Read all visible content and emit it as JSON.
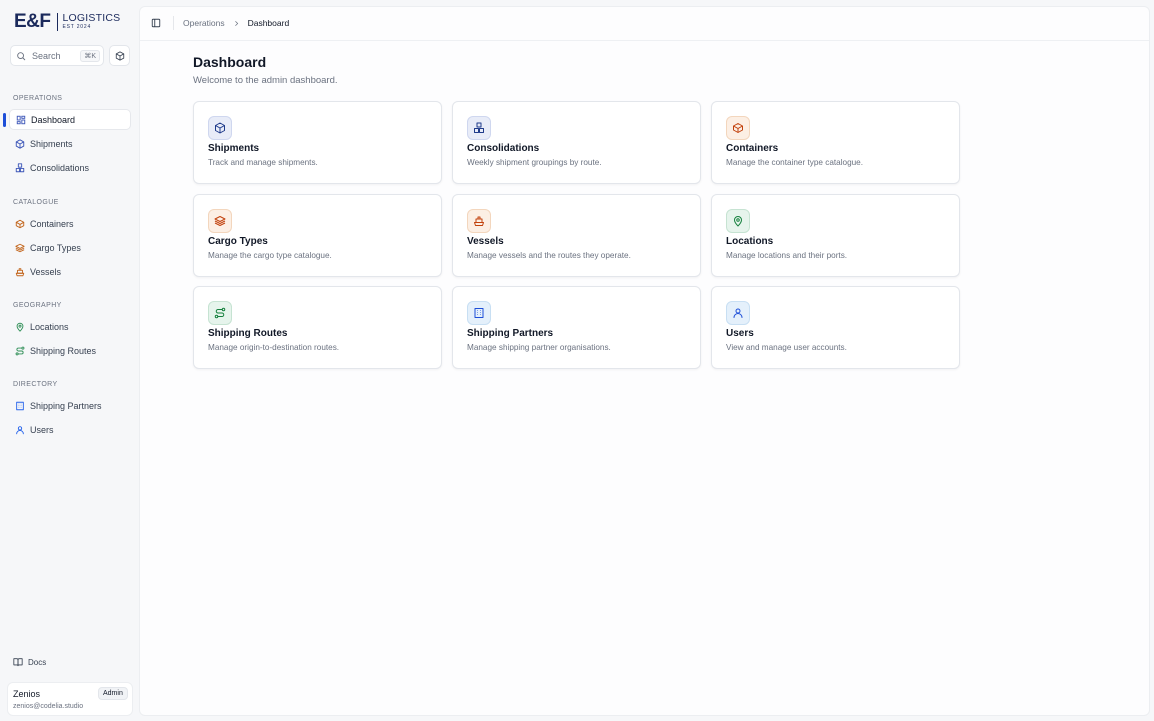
{
  "brand": {
    "mark": "E&F",
    "word": "LOGISTICS",
    "est": "EST 2024"
  },
  "search": {
    "label": "Search",
    "shortcut": "⌘K"
  },
  "sidebar": {
    "sections": [
      {
        "label": "OPERATIONS",
        "items": [
          {
            "label": "Dashboard",
            "icon": "dashboard-icon",
            "active": true
          },
          {
            "label": "Shipments",
            "icon": "box-icon"
          },
          {
            "label": "Consolidations",
            "icon": "boxes-icon"
          }
        ]
      },
      {
        "label": "CATALOGUE",
        "items": [
          {
            "label": "Containers",
            "icon": "container-icon"
          },
          {
            "label": "Cargo Types",
            "icon": "layers-icon"
          },
          {
            "label": "Vessels",
            "icon": "ship-icon"
          }
        ]
      },
      {
        "label": "GEOGRAPHY",
        "items": [
          {
            "label": "Locations",
            "icon": "map-pin-icon"
          },
          {
            "label": "Shipping Routes",
            "icon": "route-icon"
          }
        ]
      },
      {
        "label": "DIRECTORY",
        "items": [
          {
            "label": "Shipping Partners",
            "icon": "building-icon"
          },
          {
            "label": "Users",
            "icon": "user-icon"
          }
        ]
      }
    ],
    "docs": "Docs"
  },
  "user": {
    "name": "Zenios",
    "email": "zenios@codelia.studio",
    "role": "Admin"
  },
  "breadcrumb": {
    "parent": "Operations",
    "current": "Dashboard"
  },
  "page": {
    "title": "Dashboard",
    "subtitle": "Welcome to the admin dashboard."
  },
  "cards": [
    {
      "title": "Shipments",
      "desc": "Track and manage shipments.",
      "icon": "box-icon",
      "tone": "blue"
    },
    {
      "title": "Consolidations",
      "desc": "Weekly shipment groupings by route.",
      "icon": "boxes-icon",
      "tone": "blue"
    },
    {
      "title": "Containers",
      "desc": "Manage the container type catalogue.",
      "icon": "container-icon",
      "tone": "orange"
    },
    {
      "title": "Cargo Types",
      "desc": "Manage the cargo type catalogue.",
      "icon": "layers-icon",
      "tone": "orange"
    },
    {
      "title": "Vessels",
      "desc": "Manage vessels and the routes they operate.",
      "icon": "ship-icon",
      "tone": "orange"
    },
    {
      "title": "Locations",
      "desc": "Manage locations and their ports.",
      "icon": "map-pin-icon",
      "tone": "green"
    },
    {
      "title": "Shipping Routes",
      "desc": "Manage origin-to-destination routes.",
      "icon": "route-icon",
      "tone": "green"
    },
    {
      "title": "Shipping Partners",
      "desc": "Manage shipping partner organisations.",
      "icon": "building-icon",
      "tone": "sky"
    },
    {
      "title": "Users",
      "desc": "View and manage user accounts.",
      "icon": "user-icon",
      "tone": "sky"
    }
  ],
  "colors": {
    "brand": "#1b2a5c",
    "accent": "#1d4ed8",
    "blue": "#1e3a8a",
    "orange": "#c2410c",
    "green": "#15803d",
    "sky": "#1d4ed8"
  }
}
